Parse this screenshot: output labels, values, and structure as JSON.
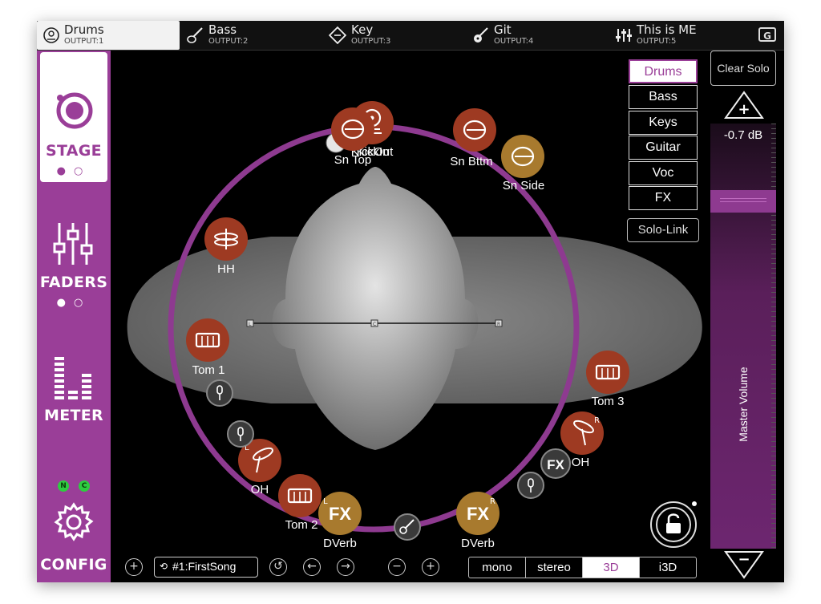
{
  "tabs": [
    {
      "name": "Drums",
      "output": "OUTPUT:1",
      "icon": "drum-icon",
      "active": true
    },
    {
      "name": "Bass",
      "output": "OUTPUT:2",
      "icon": "bass-guitar-icon"
    },
    {
      "name": "Key",
      "output": "OUTPUT:3",
      "icon": "keyboard-icon"
    },
    {
      "name": "Git",
      "output": "OUTPUT:4",
      "icon": "guitar-icon"
    },
    {
      "name": "This is ME",
      "output": "OUTPUT:5",
      "icon": "mixer-icon"
    }
  ],
  "g_button": "G",
  "sidebar": {
    "stage": "STAGE",
    "faders": "FADERS",
    "meter": "METER",
    "config": "CONFIG",
    "status": [
      "N",
      "C"
    ]
  },
  "groups": [
    "Drums",
    "Bass",
    "Keys",
    "Guitar",
    "Voc",
    "FX"
  ],
  "selected_group": "Drums",
  "solo_link": "Solo-Link",
  "clear_solo": "Clear Solo",
  "master": {
    "db": "-0.7 dB",
    "label": "Master Volume",
    "plus": "+",
    "minus": "−"
  },
  "stage_nodes": {
    "sn_top": "Sn Top",
    "kick_out": "KickOut",
    "kick_in": "KickIn",
    "sn_bttm": "Sn Bttm",
    "sn_side": "Sn Side",
    "hh": "HH",
    "tom1": "Tom 1",
    "tom2": "Tom 2",
    "tom3": "Tom 3",
    "oh_l": "OH",
    "oh_r": "OH",
    "dverb_l": "DVerb",
    "dverb_r": "DVerb",
    "fx": "FX",
    "L": "L",
    "R": "R",
    "C": "C"
  },
  "bottom": {
    "add": "+",
    "song": "#1:FirstSong",
    "undo": "↺",
    "prev": "←",
    "next": "→",
    "zoom_out": "−",
    "zoom_in": "+",
    "modes": [
      "mono",
      "stereo",
      "3D",
      "i3D"
    ],
    "selected_mode": "3D"
  },
  "colors": {
    "accent": "#9a3e98",
    "node_red": "#9e3a22",
    "node_gold": "#a87a2e"
  }
}
